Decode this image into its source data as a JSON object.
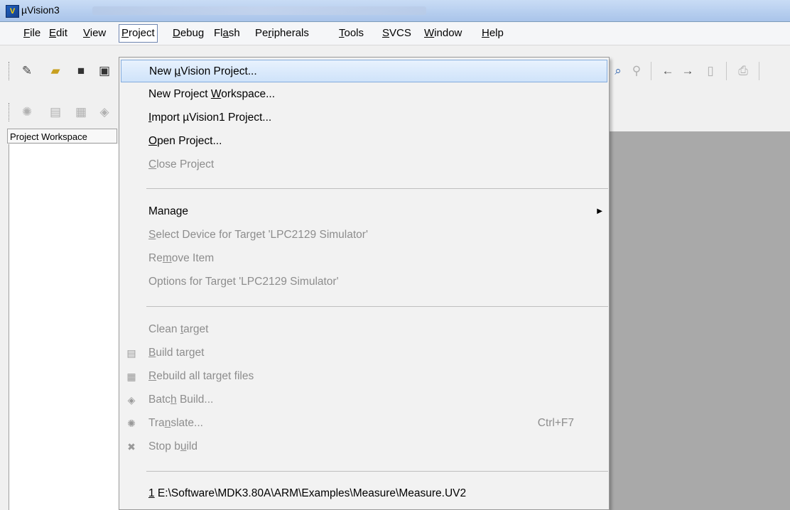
{
  "window": {
    "title": "µVision3"
  },
  "menubar": {
    "items": [
      {
        "pre": "",
        "key": "F",
        "post": "ile"
      },
      {
        "pre": "",
        "key": "E",
        "post": "dit"
      },
      {
        "pre": "",
        "key": "V",
        "post": "iew"
      },
      {
        "pre": "",
        "key": "P",
        "post": "roject"
      },
      {
        "pre": "",
        "key": "D",
        "post": "ebug"
      },
      {
        "pre": "Fl",
        "key": "a",
        "post": "sh"
      },
      {
        "pre": "Pe",
        "key": "r",
        "post": "ipherals"
      },
      {
        "pre": "",
        "key": "T",
        "post": "ools"
      },
      {
        "pre": "",
        "key": "S",
        "post": "VCS"
      },
      {
        "pre": "",
        "key": "W",
        "post": "indow"
      },
      {
        "pre": "",
        "key": "H",
        "post": "elp"
      }
    ]
  },
  "toolbar": {
    "row1_icons": [
      "new-file-icon",
      "open-folder-icon",
      "save-icon",
      "save-all-icon"
    ],
    "row2_icons": [
      "translate-icon",
      "build-icon",
      "rebuild-icon",
      "batch-build-icon"
    ],
    "right_icons": [
      "find-in-files-icon",
      "find-icon",
      "back-arrow-icon",
      "forward-arrow-icon",
      "bookmark-icon",
      "print-icon"
    ]
  },
  "workspace": {
    "header": "Project Workspace"
  },
  "dropdown": {
    "items": [
      {
        "pre": "New ",
        "key": "µ",
        "post": "Vision Project...",
        "disabled": false,
        "highlighted": true
      },
      {
        "pre": "New Project ",
        "key": "W",
        "post": "orkspace...",
        "disabled": false
      },
      {
        "pre": "",
        "key": "I",
        "post": "mport µVision1 Project...",
        "disabled": false
      },
      {
        "pre": "",
        "key": "O",
        "post": "pen Project...",
        "disabled": false
      },
      {
        "pre": "",
        "key": "C",
        "post": "lose Project",
        "disabled": true
      },
      {
        "pre": "Mana",
        "key": "g",
        "post": "e",
        "disabled": false,
        "submenu": true
      },
      {
        "pre": "",
        "key": "S",
        "post": "elect Device for Target 'LPC2129 Simulator'",
        "disabled": true
      },
      {
        "pre": "Re",
        "key": "m",
        "post": "ove Item",
        "disabled": true
      },
      {
        "pre": "",
        "key": "",
        "post": "Options for Target 'LPC2129 Simulator'",
        "disabled": true
      },
      {
        "pre": "Clean ",
        "key": "t",
        "post": "arget",
        "disabled": true
      },
      {
        "pre": "",
        "key": "B",
        "post": "uild target",
        "disabled": true,
        "icon": "build-target-icon"
      },
      {
        "pre": "",
        "key": "R",
        "post": "ebuild all target files",
        "disabled": true,
        "icon": "rebuild-icon"
      },
      {
        "pre": "Batc",
        "key": "h",
        "post": " Build...",
        "disabled": true,
        "icon": "batch-build-icon"
      },
      {
        "pre": "Tra",
        "key": "n",
        "post": "slate...",
        "disabled": true,
        "icon": "translate-icon",
        "shortcut": "Ctrl+F7"
      },
      {
        "pre": "Stop b",
        "key": "u",
        "post": "ild",
        "disabled": true,
        "icon": "stop-build-icon"
      },
      {
        "pre": "",
        "key": "1",
        "post": " E:\\Software\\MDK3.80A\\ARM\\Examples\\Measure\\Measure.UV2",
        "disabled": false
      }
    ]
  }
}
